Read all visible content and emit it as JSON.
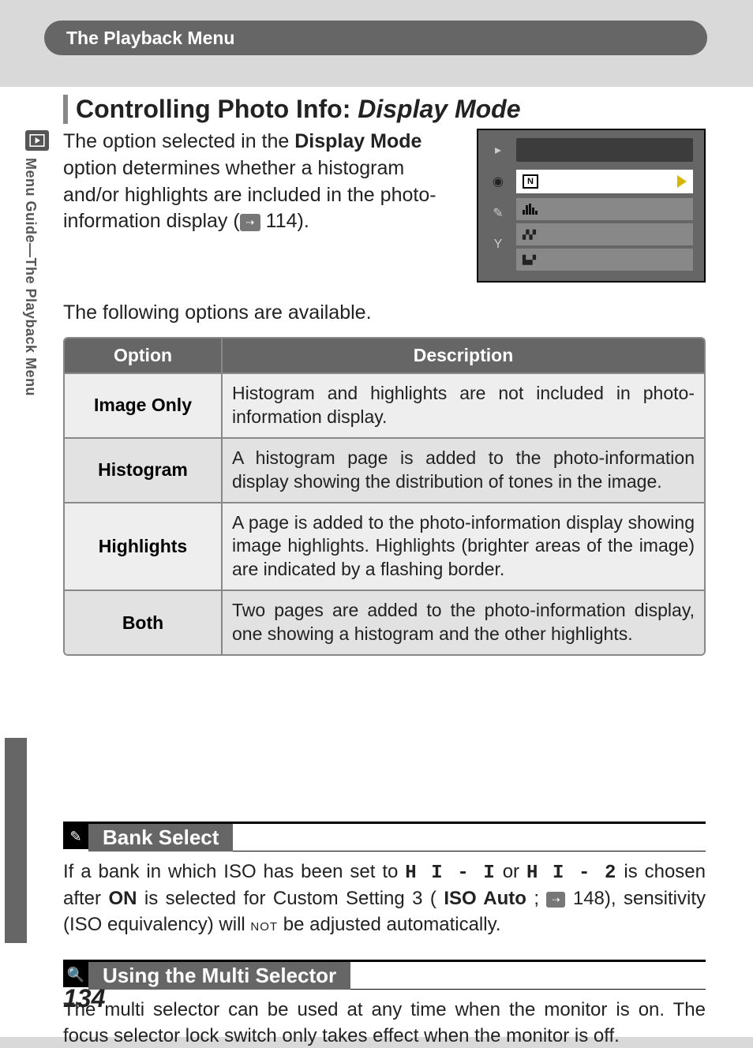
{
  "header": {
    "title": "The Playback Menu"
  },
  "spine": "Menu Guide—The Playback Menu",
  "section": {
    "title_plain": "Controlling Photo Info: ",
    "title_italic": "Display Mode",
    "intro_pre": "The option selected in the ",
    "intro_bold": "Display Mode",
    "intro_post": " option determines whether a histogram and/or highlights are included in the photo-information display (",
    "intro_pageref": " 114).",
    "available": "The following options are available."
  },
  "table": {
    "headers": {
      "option": "Option",
      "description": "Description"
    },
    "rows": [
      {
        "option": "Image Only",
        "desc": "Histogram and highlights are not included in photo-information display."
      },
      {
        "option": "Histogram",
        "desc": "A histogram page is added to the photo-information display showing the distribution of tones in the image."
      },
      {
        "option": "Highlights",
        "desc": "A page is added to the photo-information display showing image highlights.  Highlights (brighter areas of the image) are indicated by a flashing border."
      },
      {
        "option": "Both",
        "desc": "Two pages are added to the photo-information display, one showing a histogram and the other highlights."
      }
    ]
  },
  "note_bank": {
    "title": "Bank Select",
    "body_pre": "If a bank in which ISO has been set to ",
    "iso1": "H I - I",
    "body_mid1": " or ",
    "iso2": "H I - 2",
    "body_mid2": " is chosen after ",
    "on": "ON",
    "body_mid3": " is selected for Custom Setting 3 (",
    "iso_auto": "ISO Auto",
    "body_mid4": "; ",
    "pageref": " 148), sensitivity (ISO equivalency) will ",
    "not": "NOT",
    "body_post": " be adjusted automatically."
  },
  "note_multi": {
    "title": "Using the Multi Selector",
    "body": "The multi selector can be used at any time when the monitor is on.  The focus selector lock switch only takes effect when the monitor is off."
  },
  "page_number": "134"
}
